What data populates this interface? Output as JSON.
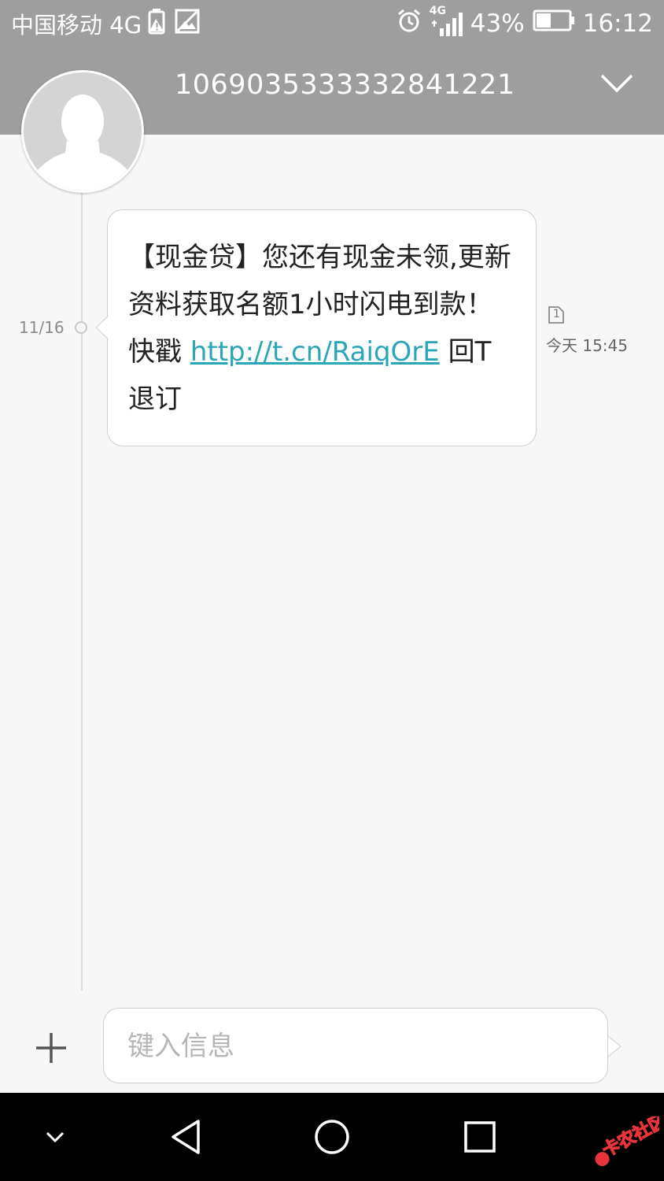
{
  "status_bar": {
    "carrier": "中国移动 4G",
    "signal_badge": "4G",
    "battery": "43%",
    "time": "16:12",
    "icons": [
      "battery-saver-icon",
      "image-icon",
      "alarm-icon",
      "signal-icon",
      "battery-icon"
    ]
  },
  "header": {
    "contact_number": "1069035333332841221",
    "icons": [
      "avatar-placeholder-icon",
      "chevron-down-icon"
    ]
  },
  "conversation": {
    "date": "11/16",
    "messages": [
      {
        "text_before_link": "【现金贷】您还有现金未领,更新资料获取名额1小时闪电到款！快戳 ",
        "link": "http://t.cn/RaiqOrE",
        "text_after_link": " 回T退订",
        "sim_slot": "1",
        "time": "今天 15:45"
      }
    ]
  },
  "composer": {
    "placeholder": "键入信息",
    "icons": [
      "plus-icon",
      "send-tail-icon"
    ]
  },
  "nav_bar": {
    "icons": [
      "hide-keyboard-icon",
      "back-icon",
      "home-icon",
      "recents-icon"
    ]
  },
  "colors": {
    "header_bg": "#9e9e9e",
    "link": "#2aa6b8",
    "page_bg": "#f7f7f8",
    "nav_bg": "#000000"
  }
}
